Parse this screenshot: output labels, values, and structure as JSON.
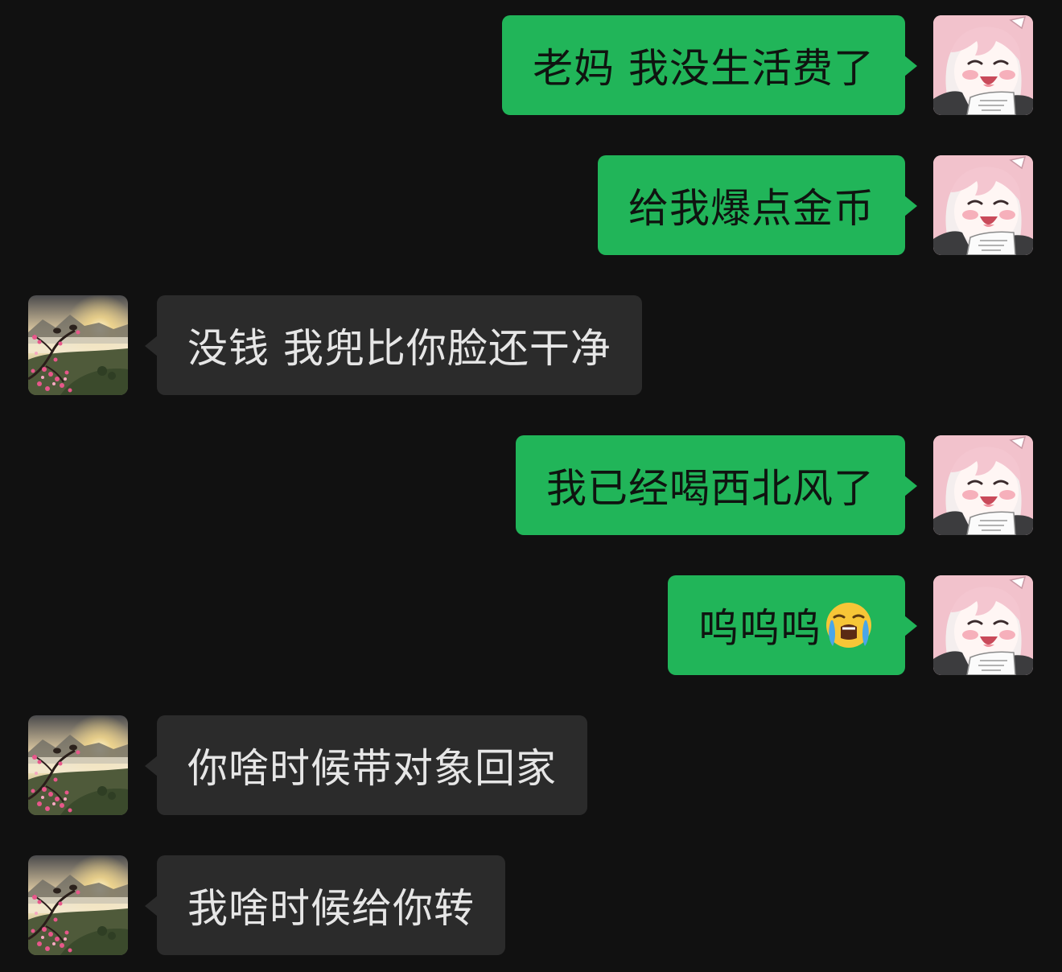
{
  "messages": [
    {
      "sender": "self",
      "text": "老妈 我没生活费了"
    },
    {
      "sender": "self",
      "text": "给我爆点金币"
    },
    {
      "sender": "other",
      "text": "没钱 我兜比你脸还干净"
    },
    {
      "sender": "self",
      "text": "我已经喝西北风了"
    },
    {
      "sender": "self",
      "text": "呜呜呜",
      "emoji": "loudly-crying-face"
    },
    {
      "sender": "other",
      "text": "你啥时候带对象回家"
    },
    {
      "sender": "other",
      "text": "我啥时候给你转"
    }
  ],
  "colors": {
    "background": "#111111",
    "self_bubble": "#21b559",
    "other_bubble": "#2b2b2b",
    "other_text": "#e6e6e6"
  },
  "avatars": {
    "self": "anime-girl-avatar",
    "other": "plum-blossom-sunrise-avatar"
  }
}
